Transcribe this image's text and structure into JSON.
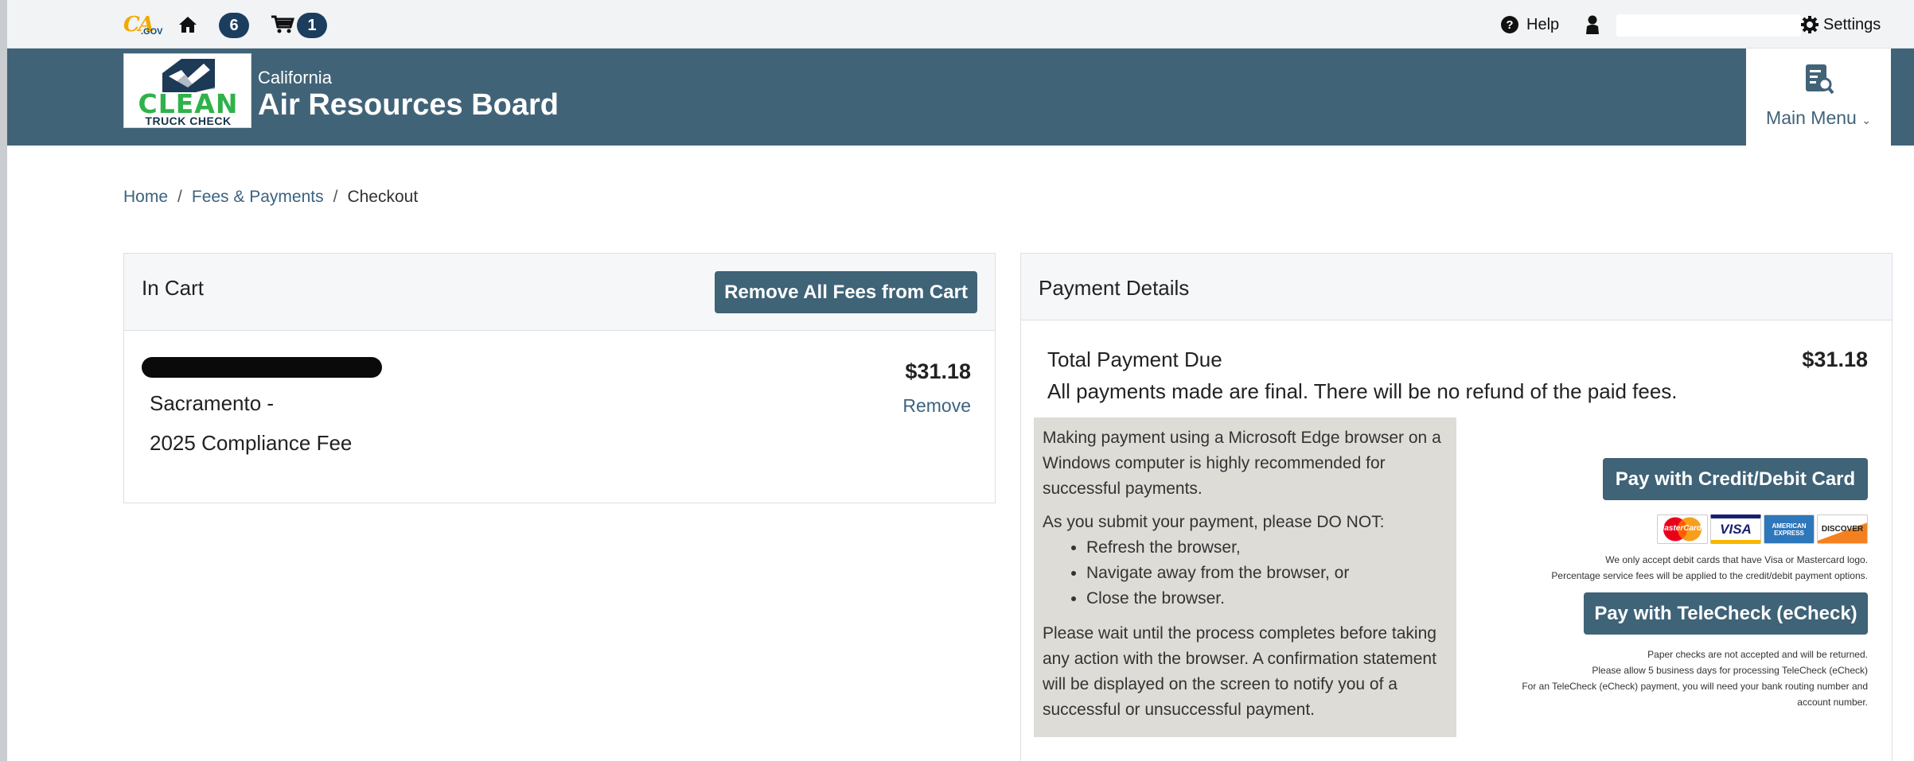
{
  "utility_bar": {
    "logo_text": "CA",
    "logo_sub": ".GOV",
    "notifications_count": "6",
    "cart_count": "1",
    "help_label": "Help",
    "settings_label": "Settings"
  },
  "header": {
    "logo_line1": "CLEAN",
    "logo_line2": "TRUCK CHECK",
    "state": "California",
    "agency": "Air Resources Board",
    "main_menu_label": "Main Menu"
  },
  "breadcrumb": {
    "home": "Home",
    "fees": "Fees & Payments",
    "current": "Checkout",
    "separator": "/"
  },
  "cart": {
    "title": "In Cart",
    "remove_all_label": "Remove All Fees from Cart",
    "item": {
      "location": "Sacramento -",
      "fee_name": "2025 Compliance Fee",
      "price": "$31.18",
      "remove_label": "Remove"
    }
  },
  "payment": {
    "title": "Payment Details",
    "total_label": "Total Payment Due",
    "total_amount": "$31.18",
    "final_note": "All payments made are final. There will be no refund of the paid fees.",
    "notice": {
      "para1": "Making payment using a Microsoft Edge browser on a Windows computer is highly recommended for successful payments.",
      "para2": "As you submit your payment, please DO NOT:",
      "bullets": [
        "Refresh the browser,",
        "Navigate away from the browser, or",
        "Close the browser."
      ],
      "para3": "Please wait until the process completes before taking any action with the browser. A confirmation statement will be displayed on the screen to notify you of a successful or unsuccessful payment."
    },
    "credit_button_label": "Pay with Credit/Debit Card",
    "card_brands": [
      "MasterCard",
      "VISA",
      "AMERICAN EXPRESS",
      "DISCOVER"
    ],
    "card_note1": "We only accept debit cards that have Visa or Mastercard logo.",
    "card_note2": "Percentage service fees will be applied to the credit/debit payment options.",
    "echeck_button_label": "Pay with TeleCheck (eCheck)",
    "echeck_note1": "Paper checks are not accepted and will be returned.",
    "echeck_note2": "Please allow 5 business days for processing TeleCheck (eCheck)",
    "echeck_note3": "For an TeleCheck (eCheck) payment, you will need your bank routing number and",
    "echeck_note4": "account number."
  },
  "colors": {
    "header_bg": "#416378",
    "button_bg": "#3f6377",
    "badge_bg": "#1c3e5e",
    "notice_bg": "#dedcd6",
    "brand_green": "#2fb24a"
  },
  "icons": [
    "home-icon",
    "cart-icon",
    "help-icon",
    "user-icon",
    "gear-icon",
    "document-search-icon",
    "chevron-down-icon"
  ]
}
